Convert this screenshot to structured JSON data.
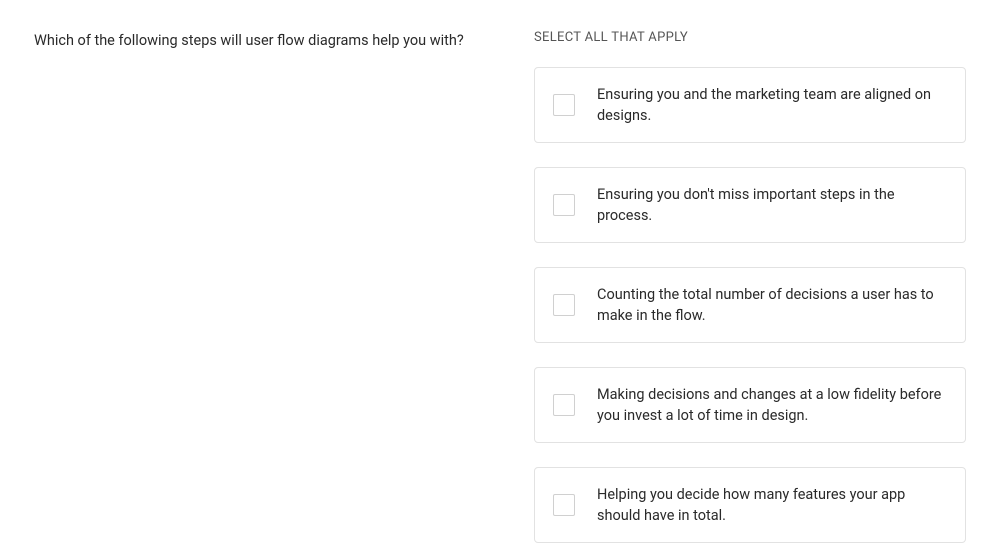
{
  "question": "Which of the following steps will user flow diagrams help you with?",
  "instruction": "SELECT ALL THAT APPLY",
  "options": [
    {
      "label": "Ensuring you and the marketing team are aligned on designs."
    },
    {
      "label": "Ensuring you don't miss important steps in the process."
    },
    {
      "label": "Counting the total number of decisions a user has to make in the flow."
    },
    {
      "label": "Making decisions and changes at a low fidelity before you invest a lot of time in design."
    },
    {
      "label": "Helping you decide how many features your app should have in total."
    }
  ]
}
